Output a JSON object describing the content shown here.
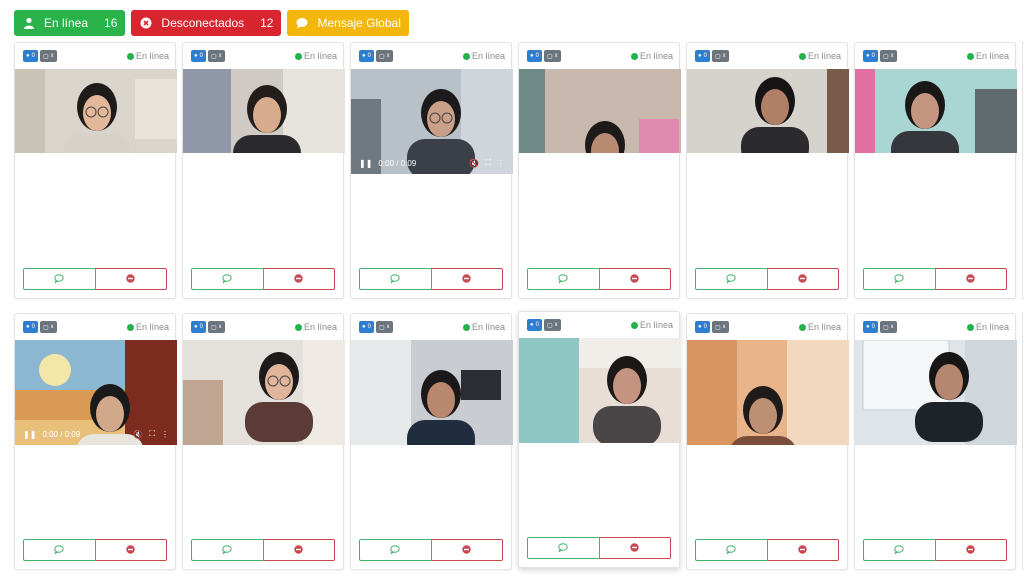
{
  "toolbar": {
    "online": {
      "label": "En línea",
      "count": "16",
      "color": "#2bb34b"
    },
    "offline": {
      "label": "Desconectados",
      "count": "12",
      "color": "#d8252f"
    },
    "global": {
      "label": "Mensaje Global",
      "color": "#f3b60d"
    }
  },
  "cards": [
    {
      "chat_count": "0",
      "doc_count": "x",
      "status": "En línea",
      "scene": "girl-glasses"
    },
    {
      "chat_count": "0",
      "doc_count": "x",
      "status": "En línea",
      "scene": "girl-window"
    },
    {
      "chat_count": "0",
      "doc_count": "x",
      "status": "En línea",
      "scene": "boy-glasses",
      "video": {
        "time": "0:00 / 0:09"
      }
    },
    {
      "chat_count": "0",
      "doc_count": "x",
      "status": "En línea",
      "scene": "girl-low"
    },
    {
      "chat_count": "0",
      "doc_count": "x",
      "status": "En línea",
      "scene": "boy-close"
    },
    {
      "chat_count": "0",
      "doc_count": "x",
      "status": "En línea",
      "scene": "boy-headset"
    },
    {
      "chat_count": "0",
      "doc_count": "x",
      "status": "En línea",
      "scene": "mural",
      "video": {
        "time": "0:00 / 0:09"
      }
    },
    {
      "chat_count": "0",
      "doc_count": "x",
      "status": "En línea",
      "scene": "girl-glasses2"
    },
    {
      "chat_count": "0",
      "doc_count": "x",
      "status": "En línea",
      "scene": "boy-room"
    },
    {
      "chat_count": "0",
      "doc_count": "x",
      "status": "En línea",
      "scene": "girl-fan",
      "raised": true
    },
    {
      "chat_count": "0",
      "doc_count": "x",
      "status": "En línea",
      "scene": "girl-orange"
    },
    {
      "chat_count": "0",
      "doc_count": "x",
      "status": "En línea",
      "scene": "boy-whiteboard"
    }
  ]
}
